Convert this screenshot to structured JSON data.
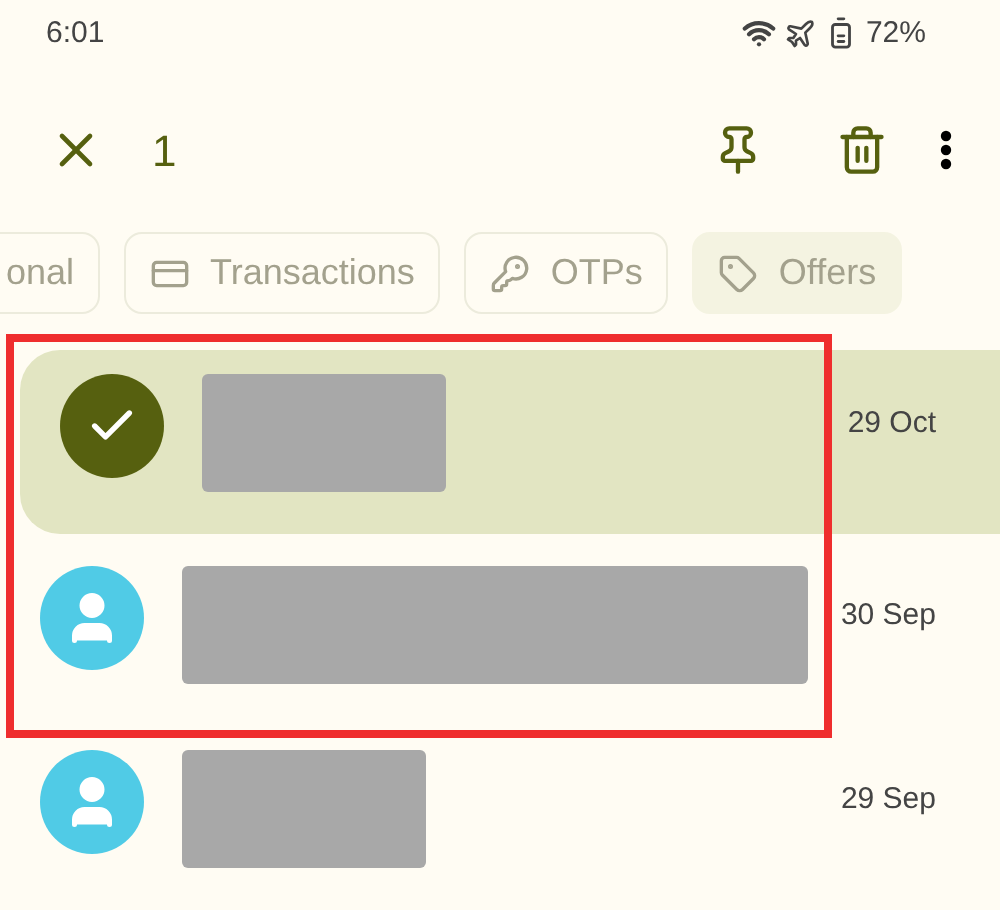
{
  "status_bar": {
    "time": "6:01",
    "battery": "72%"
  },
  "app_bar": {
    "selected_count": "1"
  },
  "chips": [
    {
      "label": "onal",
      "kind": "plain",
      "selected": false
    },
    {
      "label": "Transactions",
      "kind": "card",
      "selected": false
    },
    {
      "label": "OTPs",
      "kind": "key",
      "selected": false
    },
    {
      "label": "Offers",
      "kind": "tag",
      "selected": true
    }
  ],
  "messages": [
    {
      "date": "29 Oct",
      "selected": true,
      "kind": "short",
      "framed": true
    },
    {
      "date": "30 Sep",
      "selected": false,
      "kind": "long",
      "framed": true
    },
    {
      "date": "29 Sep",
      "selected": false,
      "kind": "short",
      "framed": false
    }
  ]
}
